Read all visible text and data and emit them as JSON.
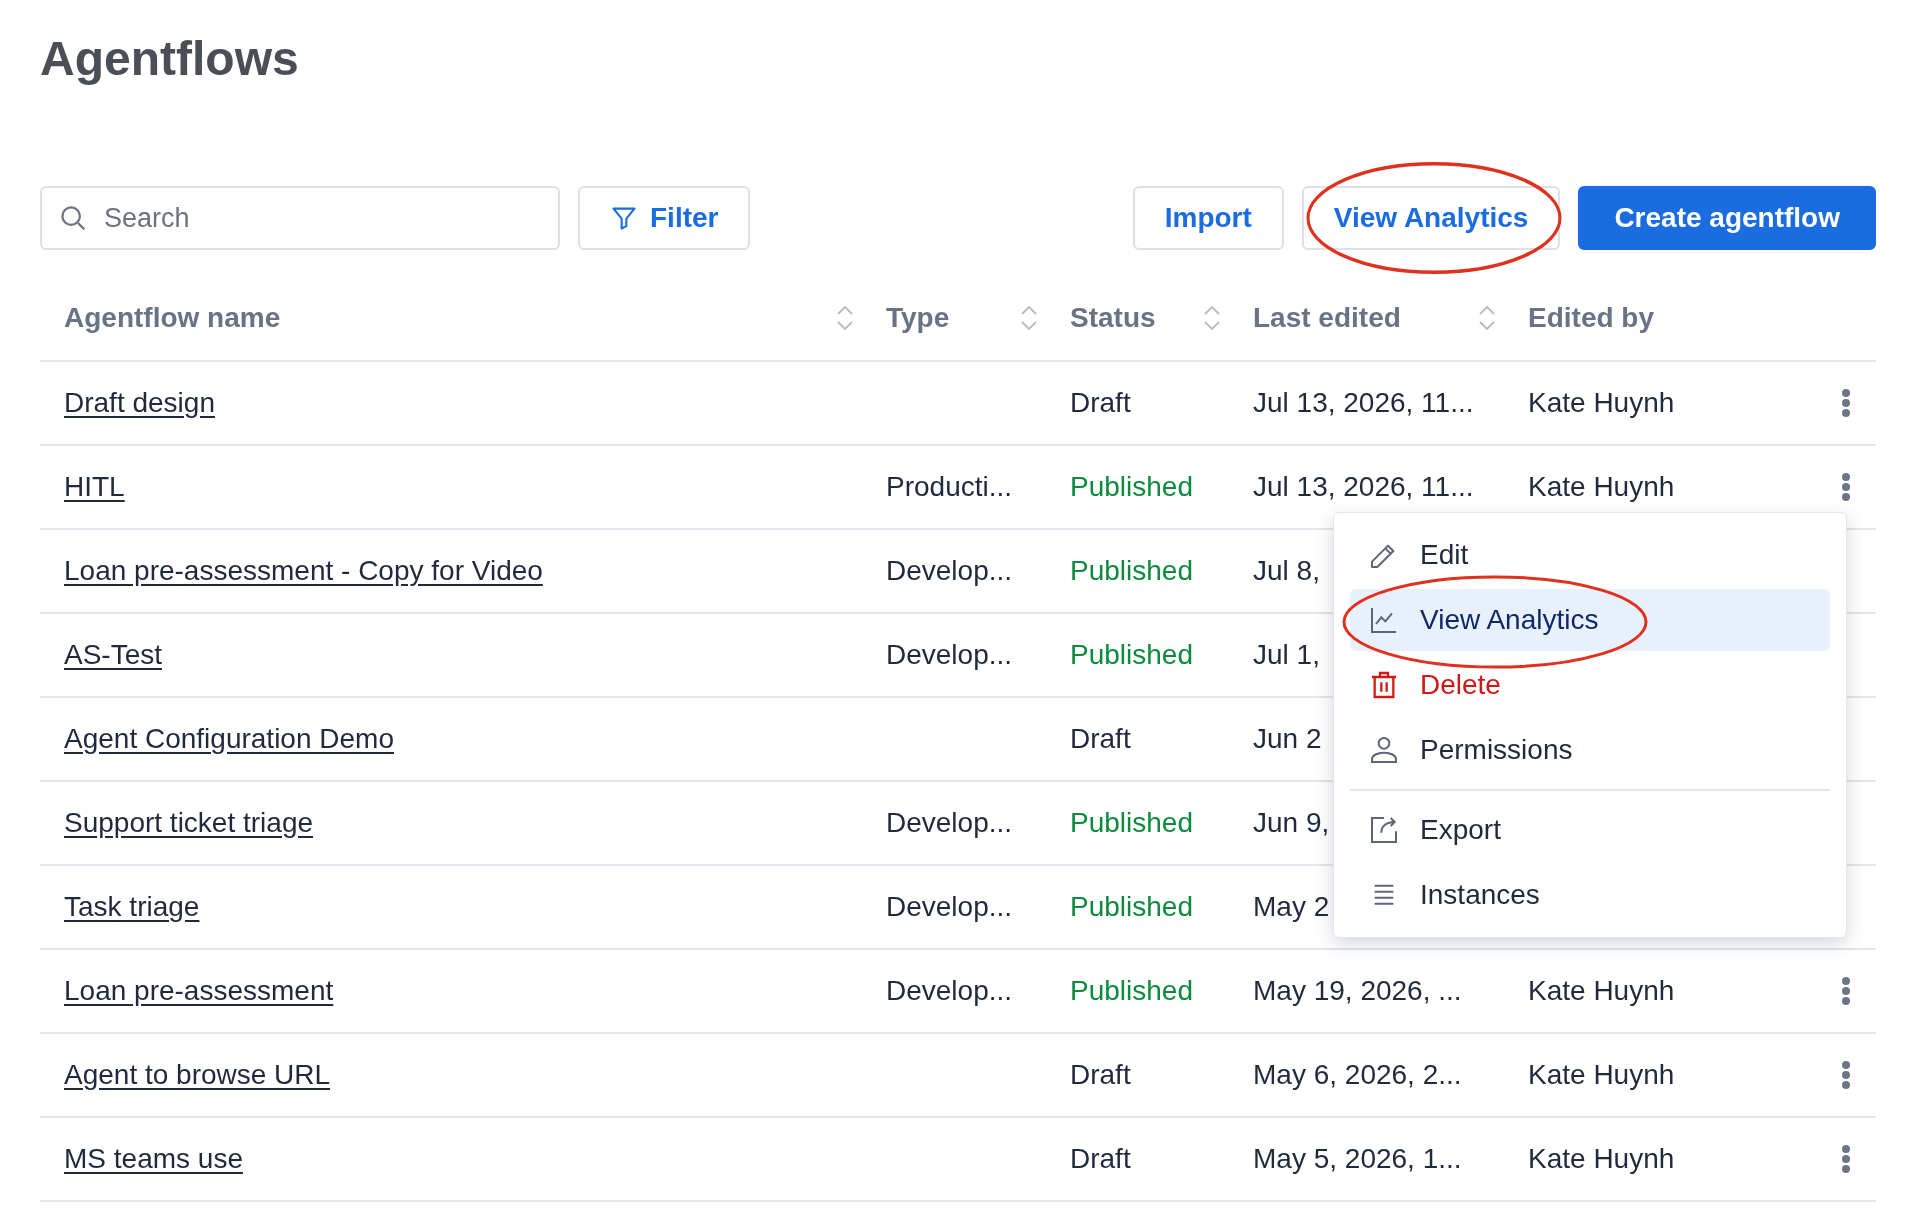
{
  "title": "Agentflows",
  "toolbar": {
    "search": {
      "placeholder": "Search"
    },
    "filter": "Filter",
    "buttons": [
      {
        "label": "Import",
        "primary": false,
        "circled": false
      },
      {
        "label": "View Analytics",
        "primary": false,
        "circled": true
      },
      {
        "label": "Create agentflow",
        "primary": true,
        "circled": false
      }
    ]
  },
  "table": {
    "columns": [
      {
        "label": "Agentflow name",
        "sortable": true
      },
      {
        "label": "Type",
        "sortable": true
      },
      {
        "label": "Status",
        "sortable": true
      },
      {
        "label": "Last edited",
        "sortable": true
      },
      {
        "label": "Edited by",
        "sortable": false
      }
    ],
    "rows": [
      {
        "name": "Draft design",
        "status": "Draft",
        "published": false,
        "last_edited": "Jul 13, 2026, 11...",
        "edited_by": "Kate Huynh"
      },
      {
        "name": "HITL",
        "type": "Producti...",
        "status": "Published",
        "published": true,
        "last_edited": "Jul 13, 2026, 11...",
        "edited_by": "Kate Huynh"
      },
      {
        "name": "Loan pre-assessment - Copy for Video",
        "type": "Develop...",
        "status": "Published",
        "published": true,
        "last_edited": "Jul 8,"
      },
      {
        "name": "AS-Test",
        "type": "Develop...",
        "status": "Published",
        "published": true,
        "last_edited": "Jul 1,"
      },
      {
        "name": "Agent Configuration Demo",
        "status": "Draft",
        "published": false,
        "last_edited": "Jun 2"
      },
      {
        "name": "Support ticket triage",
        "type": "Develop...",
        "status": "Published",
        "published": true,
        "last_edited": "Jun 9,"
      },
      {
        "name": "Task triage",
        "type": "Develop...",
        "status": "Published",
        "published": true,
        "last_edited": "May 2"
      },
      {
        "name": "Loan pre-assessment",
        "type": "Develop...",
        "status": "Published",
        "published": true,
        "last_edited": "May 19, 2026, ...",
        "edited_by": "Kate Huynh"
      },
      {
        "name": "Agent to browse URL",
        "status": "Draft",
        "published": false,
        "last_edited": "May 6, 2026, 2...",
        "edited_by": "Kate Huynh"
      },
      {
        "name": "MS teams use",
        "status": "Draft",
        "published": false,
        "last_edited": "May 5, 2026, 1...",
        "edited_by": "Kate Huynh"
      }
    ]
  },
  "context_menu": {
    "groups": [
      [
        {
          "label": "Edit",
          "kind": "edit",
          "selected": false,
          "circled": false
        },
        {
          "label": "View Analytics",
          "kind": "analytics",
          "selected": true,
          "circled": true
        },
        {
          "label": "Delete",
          "kind": "delete",
          "selected": false,
          "circled": false
        },
        {
          "label": "Permissions",
          "kind": "permissions",
          "selected": false,
          "circled": false
        }
      ],
      [
        {
          "label": "Export",
          "kind": "export",
          "selected": false,
          "circled": false
        },
        {
          "label": "Instances",
          "kind": "instances",
          "selected": false,
          "circled": false
        }
      ]
    ]
  }
}
